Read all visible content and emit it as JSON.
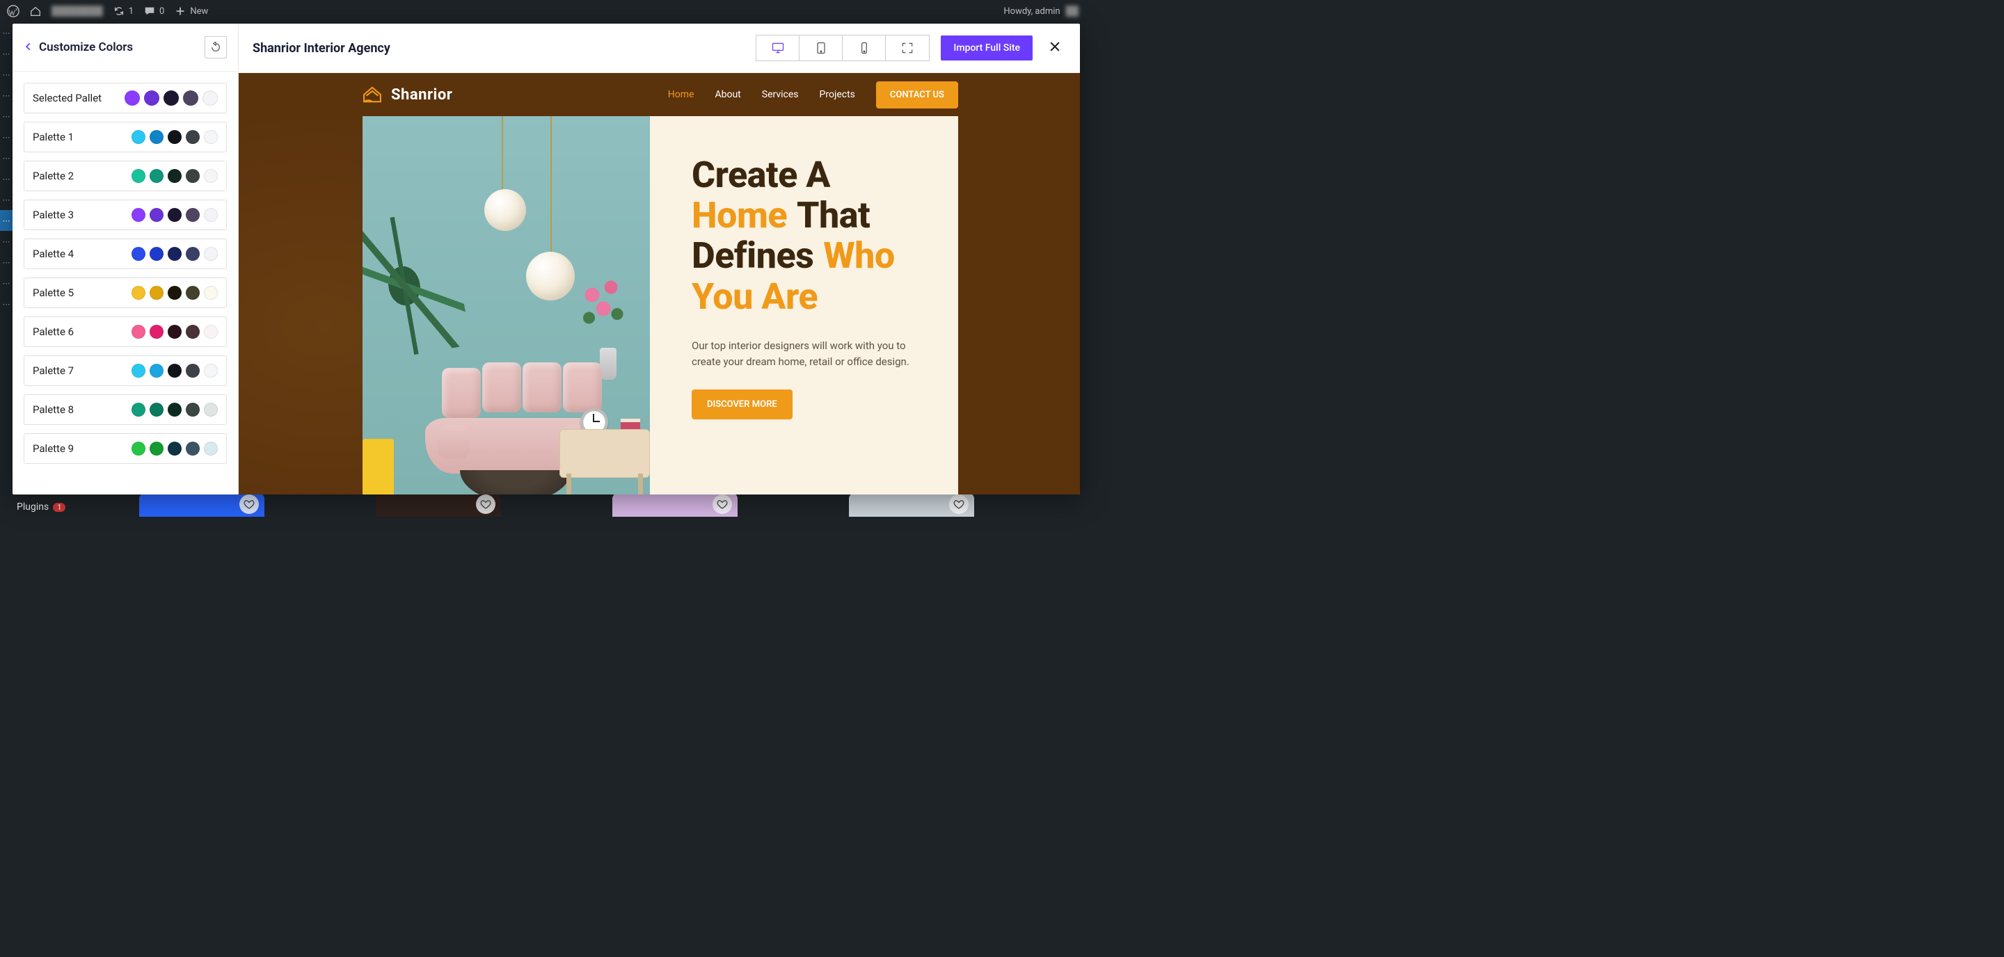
{
  "adminbar": {
    "updates": "1",
    "comments": "0",
    "new": "New",
    "howdy": "Howdy, admin"
  },
  "sidebar": {
    "plugins_label": "Plugins",
    "plugins_badge": "1"
  },
  "panel": {
    "title": "Customize Colors",
    "selected_label": "Selected Pallet",
    "selected_colors": [
      "#8b3cff",
      "#6a33d6",
      "#1d1630",
      "#4f4562",
      "#f4f3f7"
    ],
    "palettes": [
      {
        "label": "Palette 1",
        "colors": [
          "#2ac7f2",
          "#1183c9",
          "#111418",
          "#3d4248",
          "#f5f6f7"
        ]
      },
      {
        "label": "Palette 2",
        "colors": [
          "#18c29c",
          "#109678",
          "#10281f",
          "#3c423f",
          "#f5f6f7"
        ]
      },
      {
        "label": "Palette 3",
        "colors": [
          "#8b3cff",
          "#6a33d6",
          "#1d1630",
          "#4f4562",
          "#f4f3f7"
        ]
      },
      {
        "label": "Palette 4",
        "colors": [
          "#2a4de8",
          "#1f3bcd",
          "#17235e",
          "#394067",
          "#f3f4f8"
        ]
      },
      {
        "label": "Palette 5",
        "colors": [
          "#f3c02a",
          "#e0a40c",
          "#1b1708",
          "#43412a",
          "#fbf8ee"
        ]
      },
      {
        "label": "Palette 6",
        "colors": [
          "#f45f93",
          "#e21d6b",
          "#2c111c",
          "#4a3238",
          "#faf3f5"
        ]
      },
      {
        "label": "Palette 7",
        "colors": [
          "#2ac7f2",
          "#1ba6e1",
          "#101418",
          "#3d4248",
          "#f5f6f7"
        ]
      },
      {
        "label": "Palette 8",
        "colors": [
          "#139e7c",
          "#0b7a5f",
          "#0e2b22",
          "#3b4743",
          "#dfe3e2"
        ]
      },
      {
        "label": "Palette 9",
        "colors": [
          "#27c445",
          "#159a31",
          "#0d3345",
          "#3a5463",
          "#d8e9ef"
        ]
      }
    ]
  },
  "main": {
    "title": "Shanrior Interior Agency",
    "import": "Import Full Site"
  },
  "site": {
    "brand": "Shanrior",
    "nav": {
      "home": "Home",
      "about": "About",
      "services": "Services",
      "projects": "Projects",
      "contact": "CONTACT US"
    },
    "hero": {
      "line1": "Create A",
      "accent1": "Home",
      "line2": "That Defines",
      "accent2": "Who You Are",
      "body": "Our top interior designers will work with you to create your dream home, retail or office design.",
      "cta": "DISCOVER MORE"
    }
  }
}
